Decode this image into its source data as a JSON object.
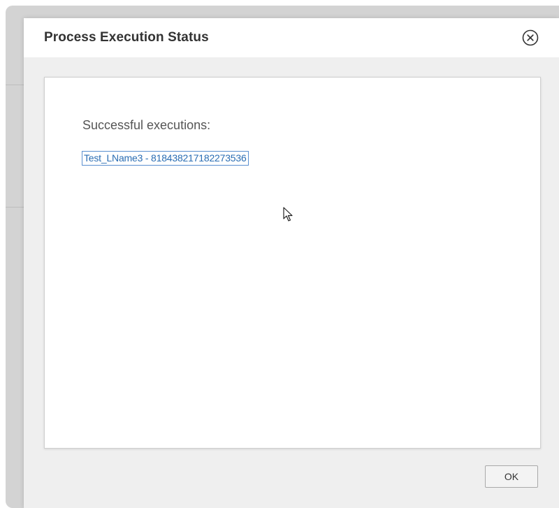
{
  "dialog": {
    "title": "Process Execution Status",
    "close_icon": "close-circle-icon"
  },
  "content": {
    "label": "Successful executions:",
    "executions": [
      {
        "text": "Test_LName3 - 818438217182273536"
      }
    ]
  },
  "footer": {
    "ok_label": "OK"
  },
  "colors": {
    "link": "#2a6db3",
    "link_border": "#5a8fd0",
    "dialog_bg": "#efefef",
    "backdrop": "#d3d3d3"
  }
}
